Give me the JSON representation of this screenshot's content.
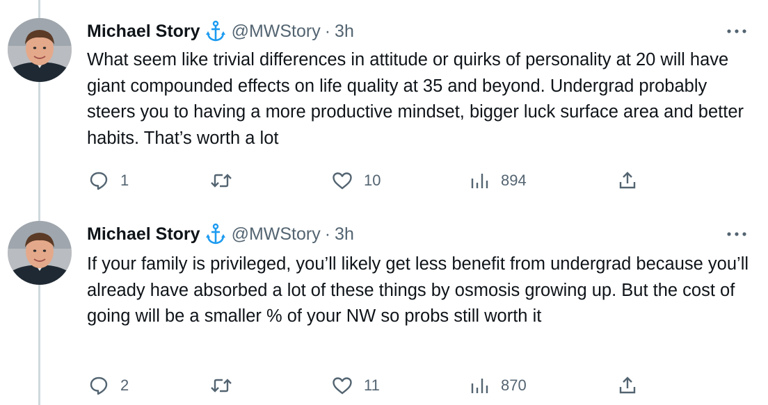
{
  "tweets": [
    {
      "author_name": "Michael Story",
      "badge_icon": "anchor-icon",
      "handle": "@MWStory",
      "separator": "·",
      "time": "3h",
      "more_icon": "more-horizontal-icon",
      "text": "What seem like trivial differences in attitude or quirks of personality at 20 will have giant compounded effects on life quality at 35 and beyond. Undergrad probably steers you to having a more productive mindset, bigger luck surface area and better habits. That’s worth a lot",
      "replies": "1",
      "retweets": "",
      "likes": "10",
      "views": "894"
    },
    {
      "author_name": "Michael Story",
      "badge_icon": "anchor-icon",
      "handle": "@MWStory",
      "separator": "·",
      "time": "3h",
      "more_icon": "more-horizontal-icon",
      "text": "If your family is privileged, you’ll likely get less benefit from undergrad because you’ll already have absorbed a lot of these things by osmosis growing up. But the cost of going will be a smaller % of your NW so probs still worth it",
      "replies": "2",
      "retweets": "",
      "likes": "11",
      "views": "870"
    }
  ],
  "colors": {
    "text_primary": "#0f1419",
    "text_secondary": "#536471",
    "badge_blue": "#1d9bf0",
    "thread_line": "#cfd9de"
  }
}
